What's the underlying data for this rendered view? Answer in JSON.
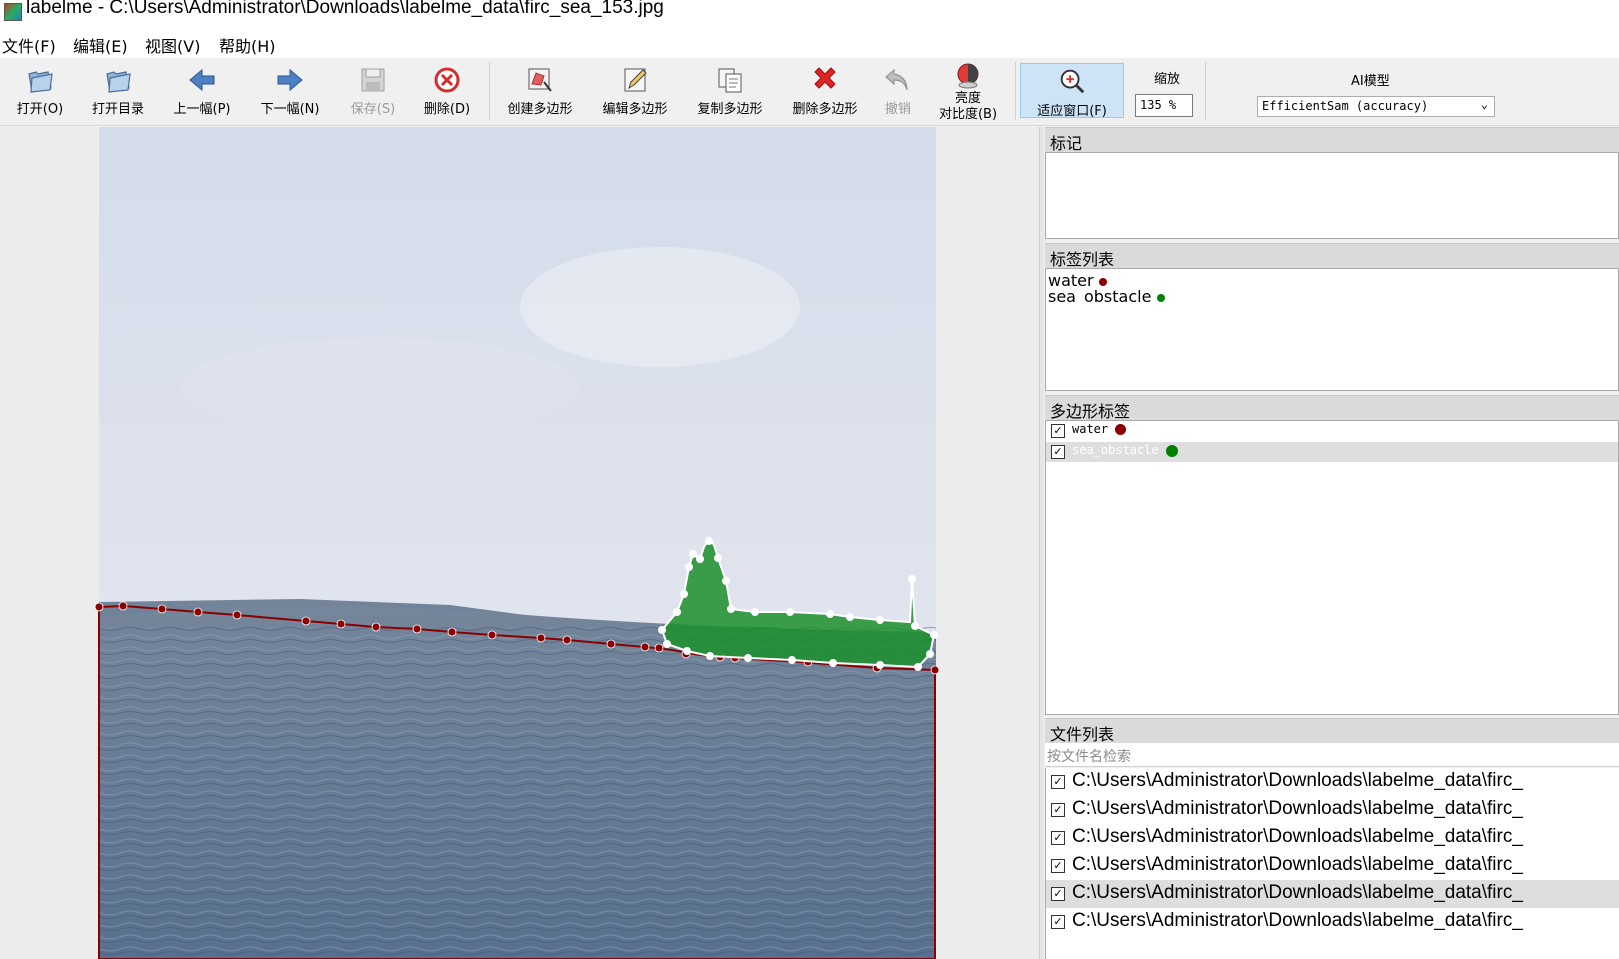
{
  "window": {
    "title": "labelme - C:\\Users\\Administrator\\Downloads\\labelme_data\\firc_sea_153.jpg"
  },
  "menu": {
    "items": [
      "文件(F)",
      "编辑(E)",
      "视图(V)",
      "帮助(H)"
    ]
  },
  "toolbar": {
    "open": "打开(O)",
    "open_dir": "打开目录",
    "prev": "上一幅(P)",
    "next": "下一幅(N)",
    "save": "保存(S)",
    "delete_file": "删除(D)",
    "create_polygon": "创建多边形",
    "edit_polygon": "编辑多边形",
    "copy_polygon": "复制多边形",
    "delete_polygon": "删除多边形",
    "undo": "撤销",
    "brightness_line1": "亮度",
    "brightness_line2": "对比度(B)",
    "fit_window": "适应窗口(F)",
    "zoom_label": "缩放",
    "zoom_value": "135 %",
    "ai_label": "AI模型",
    "ai_model": "EfficientSam (accuracy)"
  },
  "panels": {
    "flags_title": "标记",
    "label_list_title": "标签列表",
    "label_list": [
      {
        "name": "water",
        "color": "#8b0000"
      },
      {
        "name": "sea_obstacle",
        "color": "#008000"
      }
    ],
    "polygon_labels_title": "多边形标签",
    "polygon_labels": [
      {
        "name": "water",
        "color": "#8b0000",
        "checked": true,
        "selected": false
      },
      {
        "name": "sea_obstacle",
        "color": "#008000",
        "checked": true,
        "selected": true
      }
    ],
    "file_list_title": "文件列表",
    "file_search_placeholder": "按文件名检索",
    "files": [
      {
        "path": "C:\\Users\\Administrator\\Downloads\\labelme_data\\firc_",
        "checked": true,
        "selected": false
      },
      {
        "path": "C:\\Users\\Administrator\\Downloads\\labelme_data\\firc_",
        "checked": true,
        "selected": false
      },
      {
        "path": "C:\\Users\\Administrator\\Downloads\\labelme_data\\firc_",
        "checked": true,
        "selected": false
      },
      {
        "path": "C:\\Users\\Administrator\\Downloads\\labelme_data\\firc_",
        "checked": true,
        "selected": false
      },
      {
        "path": "C:\\Users\\Administrator\\Downloads\\labelme_data\\firc_",
        "checked": true,
        "selected": true
      },
      {
        "path": "C:\\Users\\Administrator\\Downloads\\labelme_data\\firc_",
        "checked": true,
        "selected": false
      }
    ]
  },
  "colors": {
    "water": "#8b0000",
    "sea_obstacle": "#008000",
    "selection_fill": "#1a8f2a"
  }
}
